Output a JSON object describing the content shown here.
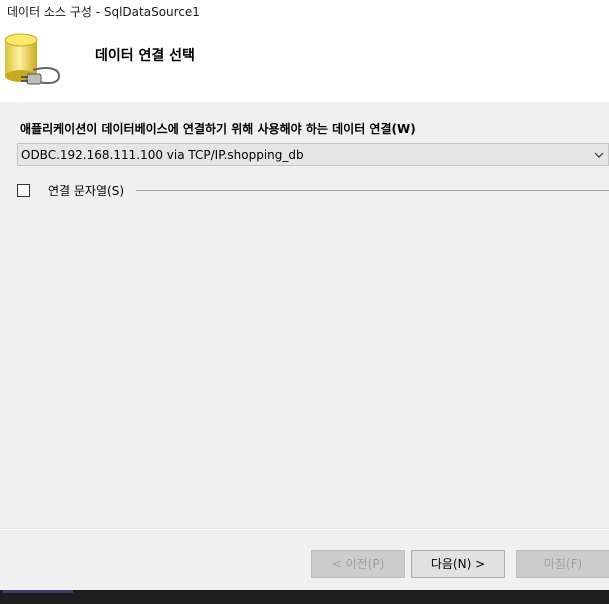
{
  "window": {
    "title": "데이터 소스 구성 - SqlDataSource1"
  },
  "header": {
    "title": "데이터 연결 선택",
    "icon": "database-plug-icon"
  },
  "connection": {
    "label": "애플리케이션이 데이터베이스에 연결하기 위해 사용해야 하는 데이터 연결(W)",
    "selected": "ODBC.192.168.111.100 via TCP/IP.shopping_db"
  },
  "connection_string": {
    "label": "연결 문자열(S)",
    "checked": false
  },
  "buttons": {
    "prev": "< 이전(P)",
    "next": "다음(N) >",
    "finish": "마침(F)"
  }
}
